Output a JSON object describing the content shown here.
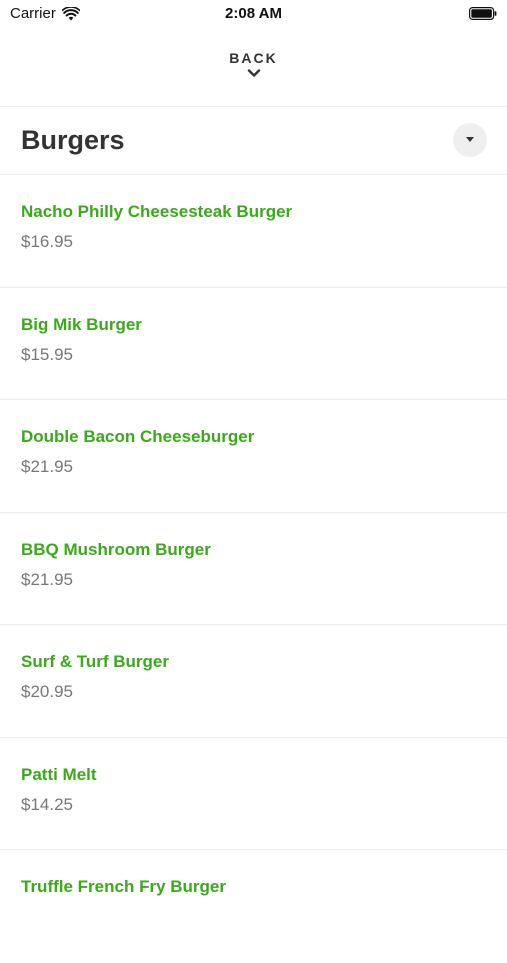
{
  "status_bar": {
    "carrier": "Carrier",
    "time": "2:08 AM"
  },
  "header": {
    "back_label": "BACK"
  },
  "category": {
    "title": "Burgers"
  },
  "items": [
    {
      "name": "Nacho Philly Cheesesteak Burger",
      "price": "$16.95"
    },
    {
      "name": "Big Mik Burger",
      "price": "$15.95"
    },
    {
      "name": "Double Bacon Cheeseburger",
      "price": "$21.95"
    },
    {
      "name": "BBQ Mushroom Burger",
      "price": "$21.95"
    },
    {
      "name": "Surf & Turf Burger",
      "price": "$20.95"
    },
    {
      "name": "Patti Melt",
      "price": "$14.25"
    },
    {
      "name": "Truffle French Fry Burger",
      "price": ""
    }
  ],
  "colors": {
    "item_name": "#3aaa1a",
    "price": "#777777",
    "title": "#333333"
  },
  "icons": {
    "wifi": "wifi-icon",
    "battery": "battery-icon",
    "back": "chevron-down-icon",
    "dropdown": "caret-down-icon"
  }
}
